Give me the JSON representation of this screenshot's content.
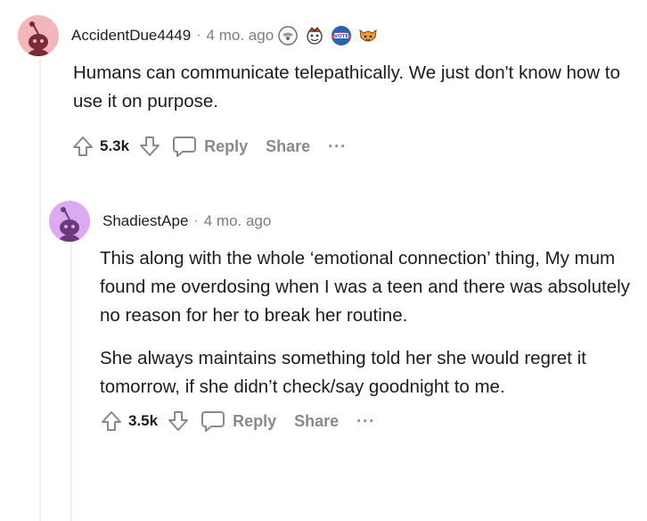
{
  "comments": [
    {
      "username": "AccidentDue4449",
      "age": "4 mo. ago",
      "avatar_color": "#f0a0a8",
      "awards": [
        "clown-award-icon",
        "wholesome-award-icon",
        "vote-award-icon",
        "cat-award-icon"
      ],
      "body": [
        "Humans can communicate telepathically. We just don't know how to use it on purpose."
      ],
      "score": "5.3k",
      "reply_label": "Reply",
      "share_label": "Share",
      "more_label": "···"
    },
    {
      "username": "ShadiestApe",
      "age": "4 mo. ago",
      "avatar_color": "#d9a3ee",
      "awards": [],
      "body": [
        "This along with the whole ‘emotional connection’ thing, My mum found me overdosing when I was a teen and there was absolutely no reason for her to break her routine.",
        "She always maintains something told her she would regret it tomorrow, if she didn’t check/say goodnight to me."
      ],
      "score": "3.5k",
      "reply_label": "Reply",
      "share_label": "Share",
      "more_label": "···"
    }
  ],
  "separator": "·"
}
